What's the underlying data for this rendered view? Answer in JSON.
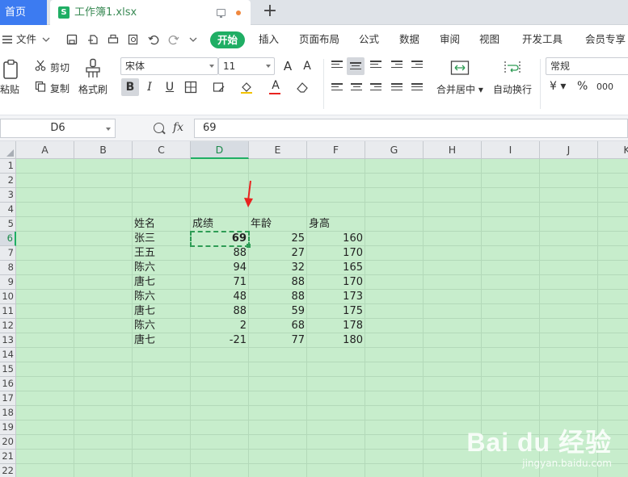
{
  "tabs": {
    "home": "首页",
    "file": "工作簿1.xlsx",
    "file_icon": "S",
    "new_tab": "+"
  },
  "quick_access": {
    "file_menu": "文件"
  },
  "menu": [
    "开始",
    "插入",
    "页面布局",
    "公式",
    "数据",
    "审阅",
    "视图",
    "开发工具",
    "会员专享"
  ],
  "ribbon": {
    "paste": "粘贴",
    "cut": "剪切",
    "copy": "复制",
    "format_painter": "格式刷",
    "font_name": "宋体",
    "font_size": "11",
    "bold": "B",
    "italic": "I",
    "underline": "U",
    "grow_font": "A",
    "shrink_font": "A",
    "font_color": "A",
    "merge_center": "合并居中",
    "wrap_text": "自动换行",
    "number_format": "常规",
    "currency": "¥",
    "percent": "%",
    "thousands": "000"
  },
  "formula_bar": {
    "cell_ref": "D6",
    "fx": "fx",
    "value": "69"
  },
  "columns": [
    "A",
    "B",
    "C",
    "D",
    "E",
    "F",
    "G",
    "H",
    "I",
    "J",
    "K"
  ],
  "rows": [
    "1",
    "2",
    "3",
    "4",
    "5",
    "6",
    "7",
    "8",
    "9",
    "10",
    "11",
    "12",
    "13",
    "14",
    "15",
    "16",
    "17",
    "18",
    "19",
    "20",
    "21",
    "22"
  ],
  "headers": [
    "姓名",
    "成绩",
    "年龄",
    "身高"
  ],
  "table_rows": [
    [
      "张三",
      "69",
      "25",
      "160"
    ],
    [
      "王五",
      "88",
      "27",
      "170"
    ],
    [
      "陈六",
      "94",
      "32",
      "165"
    ],
    [
      "唐七",
      "71",
      "88",
      "170"
    ],
    [
      "陈六",
      "48",
      "88",
      "173"
    ],
    [
      "唐七",
      "88",
      "59",
      "175"
    ],
    [
      "陈六",
      "2",
      "68",
      "178"
    ],
    [
      "唐七",
      "-21",
      "77",
      "180"
    ]
  ],
  "colors": {
    "accent": "#1fae64",
    "tab_blue": "#3c7bf1",
    "sheet_bg": "#c7edcc",
    "arrow": "#e8231f"
  },
  "watermark": {
    "logo": "Bai du 经验",
    "url": "jingyan.baidu.com"
  }
}
